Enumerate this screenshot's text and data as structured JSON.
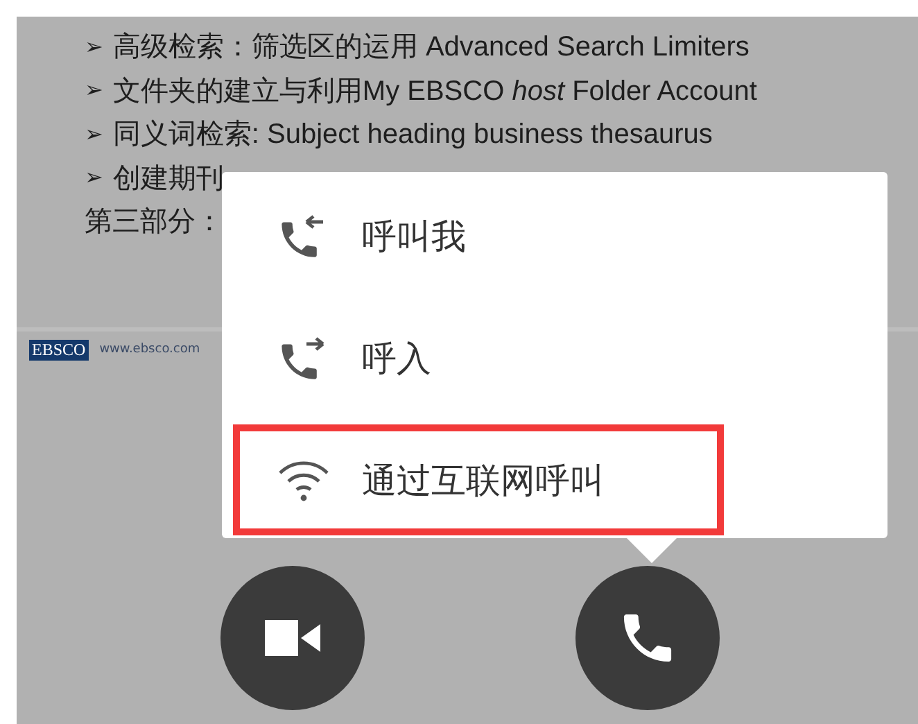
{
  "slide": {
    "lines": [
      {
        "bullet": "➢",
        "text": "高级检索：筛选区的运用 Advanced Search Limiters"
      },
      {
        "bullet": "➢",
        "text": "文件夹的建立与利用My EBSCO *host* Folder Account"
      },
      {
        "bullet": "➢",
        "text": "同义词检索: Subject heading business thesaurus"
      },
      {
        "bullet": "➢",
        "text": "创建期刊"
      },
      {
        "text": "第三部分："
      }
    ],
    "logo": "EBSCO",
    "url": "www.ebsco.com"
  },
  "menu": {
    "items": [
      {
        "kind": "call-me",
        "label": "呼叫我",
        "highlighted": false
      },
      {
        "kind": "call-in",
        "label": "呼入",
        "highlighted": false
      },
      {
        "kind": "internet",
        "label": "通过互联网呼叫",
        "highlighted": true
      }
    ]
  },
  "call_buttons": [
    {
      "kind": "video"
    },
    {
      "kind": "phone"
    }
  ]
}
